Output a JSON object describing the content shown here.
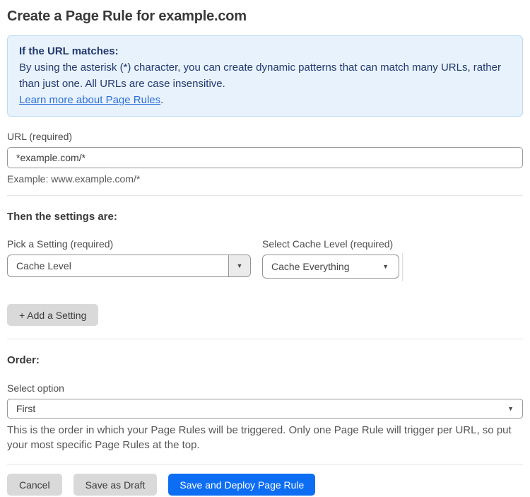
{
  "page": {
    "title": "Create a Page Rule for example.com"
  },
  "info_box": {
    "heading": "If the URL matches:",
    "body": "By using the asterisk (*) character, you can create dynamic patterns that can match many URLs, rather than just one. All URLs are case insensitive.",
    "link_label": "Learn more about Page Rules",
    "link_suffix": "."
  },
  "url_field": {
    "label": "URL (required)",
    "value": "*example.com/*",
    "hint": "Example: www.example.com/*"
  },
  "settings": {
    "heading": "Then the settings are:",
    "setting_picker": {
      "label": "Pick a Setting (required)",
      "value": "Cache Level"
    },
    "cache_level_picker": {
      "label": "Select Cache Level (required)",
      "value": "Cache Everything"
    },
    "add_button_label": "+ Add a Setting"
  },
  "order": {
    "heading": "Order:",
    "label": "Select option",
    "value": "First",
    "hint": "This is the order in which your Page Rules will be triggered. Only one Page Rule will trigger per URL, so put your most specific Page Rules at the top."
  },
  "actions": {
    "cancel_label": "Cancel",
    "save_draft_label": "Save as Draft",
    "save_deploy_label": "Save and Deploy Page Rule"
  },
  "icons": {
    "dropdown_caret": "▼"
  },
  "colors": {
    "info_box_bg": "#e8f2fc",
    "info_box_border": "#bcd9f5",
    "info_text": "#22396e",
    "link": "#2d6fd6",
    "primary_button_bg": "#0d6ef4",
    "gray_button_bg": "#d9d9d9",
    "heading_text": "#393939"
  }
}
